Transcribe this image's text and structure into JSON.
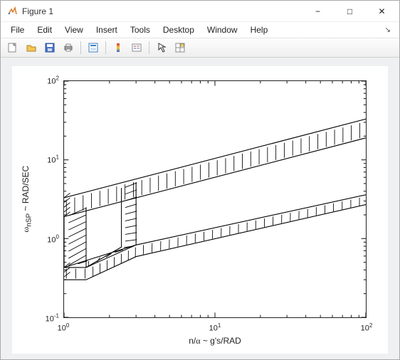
{
  "window": {
    "title": "Figure 1",
    "controls": {
      "minimize": "−",
      "maximize": "□",
      "close": "✕"
    }
  },
  "menu": {
    "items": [
      "File",
      "Edit",
      "View",
      "Insert",
      "Tools",
      "Desktop",
      "Window",
      "Help"
    ]
  },
  "toolbar": {
    "icons": [
      "new-figure-icon",
      "open-icon",
      "save-icon",
      "print-icon",
      "sep",
      "print-preview-icon",
      "sep",
      "colorbar-icon",
      "legend-icon",
      "sep",
      "pointer-icon",
      "data-cursor-icon"
    ]
  },
  "chart_data": {
    "type": "line",
    "xlabel": "n/α ~ g's/RAD",
    "ylabel": "ω_nSP ~ RAD/SEC",
    "xscale": "log",
    "yscale": "log",
    "xlim": [
      1,
      100
    ],
    "ylim": [
      0.1,
      100
    ],
    "xticks": [
      1,
      10,
      100
    ],
    "xtick_labels": [
      "10^0",
      "10^1",
      "10^2"
    ],
    "yticks": [
      0.1,
      1,
      10,
      100
    ],
    "ytick_labels": [
      "10^-1",
      "10^0",
      "10^1",
      "10^2"
    ],
    "series": [
      {
        "name": "upper_outer",
        "x": [
          1,
          100
        ],
        "y": [
          3.3,
          33
        ]
      },
      {
        "name": "upper_inner",
        "x": [
          1,
          100
        ],
        "y": [
          1.9,
          19
        ]
      },
      {
        "name": "lower_inner",
        "x": [
          1,
          1.4,
          3,
          100
        ],
        "y": [
          0.43,
          0.43,
          0.83,
          3.6
        ]
      },
      {
        "name": "lower_outer",
        "x": [
          1,
          1.4,
          3,
          100
        ],
        "y": [
          0.3,
          0.3,
          0.59,
          2.7
        ]
      },
      {
        "name": "box_outer",
        "x": [
          1,
          1,
          3,
          3
        ],
        "y": [
          1.9,
          0.43,
          0.83,
          5.2
        ]
      },
      {
        "name": "box_inner",
        "x": [
          1.4,
          1.4,
          2.4,
          2.4
        ],
        "y": [
          2.5,
          0.43,
          0.78,
          4.4
        ]
      }
    ],
    "hatching": "between paired boundaries"
  }
}
